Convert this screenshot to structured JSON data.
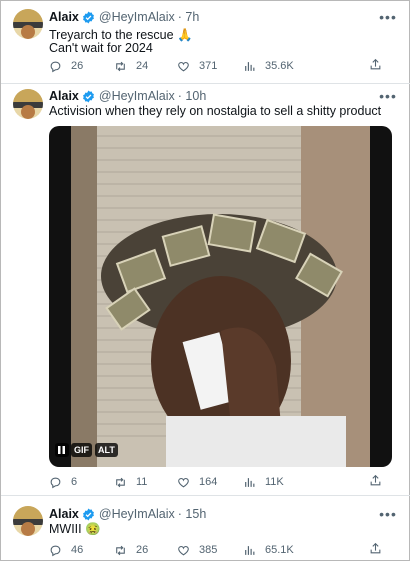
{
  "tweets": [
    {
      "name": "Alaix",
      "handle": "@HeyImAlaix",
      "time": "· 7h",
      "lines": [
        "Treyarch to the rescue 🙏",
        "Can't wait for 2024"
      ],
      "stats": {
        "replies": "26",
        "reposts": "24",
        "likes": "371",
        "views": "35.6K"
      }
    },
    {
      "name": "Alaix",
      "handle": "@HeyImAlaix",
      "time": "· 10h",
      "lines": [
        "Activision when they rely on nostalgia to sell a shitty product"
      ],
      "media": {
        "badge_gif": "GIF",
        "badge_alt": "ALT"
      },
      "stats": {
        "replies": "6",
        "reposts": "11",
        "likes": "164",
        "views": "11K"
      }
    },
    {
      "name": "Alaix",
      "handle": "@HeyImAlaix",
      "time": "· 15h",
      "lines": [
        "MWIII 🤢"
      ],
      "stats": {
        "replies": "46",
        "reposts": "26",
        "likes": "385",
        "views": "65.1K"
      }
    }
  ],
  "icons": {
    "more": "more-icon",
    "reply": "reply-icon",
    "repost": "repost-icon",
    "like": "like-icon",
    "views": "views-icon",
    "share": "share-icon",
    "verified": "verified-badge-icon",
    "pause": "pause-icon"
  },
  "colors": {
    "verified": "#1d9bf0",
    "muted": "#536471",
    "text": "#0f1419"
  }
}
